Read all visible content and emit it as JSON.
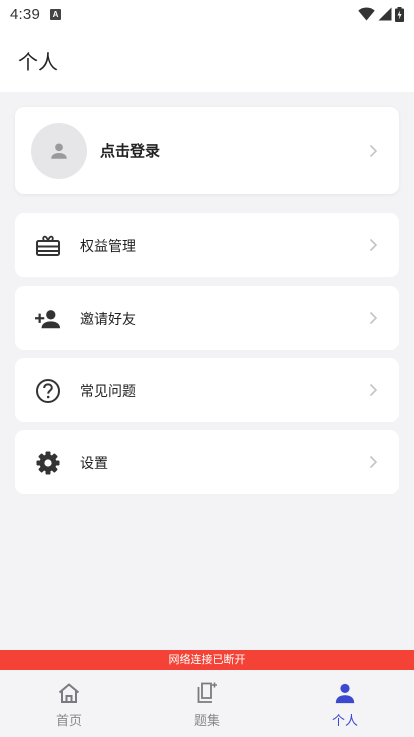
{
  "status_bar": {
    "time": "4:39",
    "notification_icon": "A"
  },
  "header": {
    "title": "个人"
  },
  "login_card": {
    "label": "点击登录",
    "avatar_icon": "person-icon"
  },
  "menu": {
    "items": [
      {
        "label": "权益管理",
        "icon": "gift-card-icon"
      },
      {
        "label": "邀请好友",
        "icon": "person-add-icon"
      },
      {
        "label": "常见问题",
        "icon": "help-circle-icon"
      },
      {
        "label": "设置",
        "icon": "gear-icon"
      }
    ]
  },
  "offline_banner": {
    "text": "网络连接已断开"
  },
  "bottom_nav": {
    "items": [
      {
        "label": "首页",
        "icon": "home-icon",
        "active": false
      },
      {
        "label": "题集",
        "icon": "question-set-icon",
        "active": false
      },
      {
        "label": "个人",
        "icon": "person-icon",
        "active": true
      }
    ]
  },
  "colors": {
    "accent": "#3b49d1",
    "banner": "#f44336",
    "background": "#f3f3f5"
  }
}
